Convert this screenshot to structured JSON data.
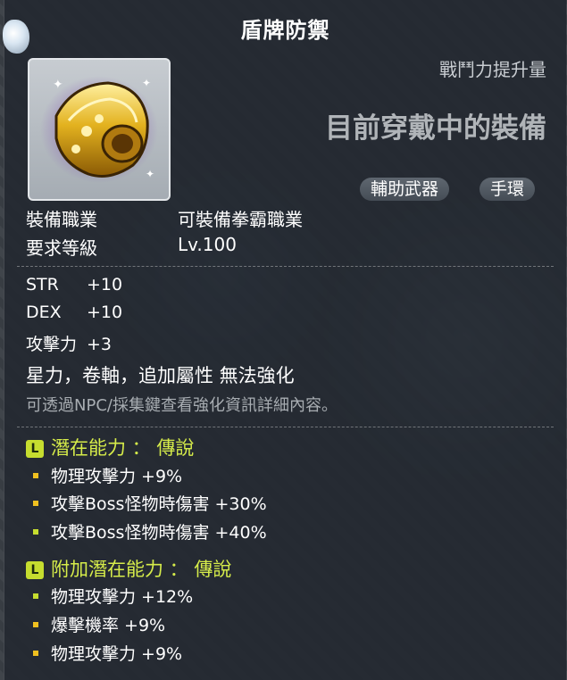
{
  "item": {
    "name": "盾牌防禦",
    "stat_compare_label": "戰鬥力提升量",
    "equipped_label": "目前穿戴中的裝備",
    "chips": [
      "輔助武器",
      "手環"
    ]
  },
  "requirements": [
    {
      "key": "裝備職業",
      "value": "可裝備拳霸職業"
    },
    {
      "key": "要求等級",
      "value": "Lv.100"
    }
  ],
  "stats": [
    {
      "key": "STR",
      "value": "+10"
    },
    {
      "key": "DEX",
      "value": "+10"
    },
    {
      "key": "攻擊力",
      "value": "+3"
    }
  ],
  "notice": "星力，卷軸，追加屬性 無法強化",
  "hint": "可透過NPC/採集鍵查看強化資訊詳細內容。",
  "potential": {
    "badge": "L",
    "title": "潛在能力 ： 傳說",
    "lines": [
      {
        "text": "物理攻擊力 +9%",
        "color": "gold"
      },
      {
        "text": "攻擊Boss怪物時傷害 +30%",
        "color": "gold"
      },
      {
        "text": "攻擊Boss怪物時傷害 +40%",
        "color": "green"
      }
    ]
  },
  "additional_potential": {
    "badge": "L",
    "title": "附加潛在能力 ： 傳說",
    "lines": [
      {
        "text": "物理攻擊力 +12%",
        "color": "green"
      },
      {
        "text": "爆擊機率 +9%",
        "color": "gold"
      },
      {
        "text": "物理攻擊力 +9%",
        "color": "gold"
      }
    ]
  },
  "colors": {
    "legendary": "#c6dd2f",
    "tier_gold": "#f0c020",
    "text_main": "#ffffff",
    "text_dim": "#a8adb2"
  },
  "icons": [
    "shield-emblem-icon",
    "legendary-badge-icon"
  ]
}
